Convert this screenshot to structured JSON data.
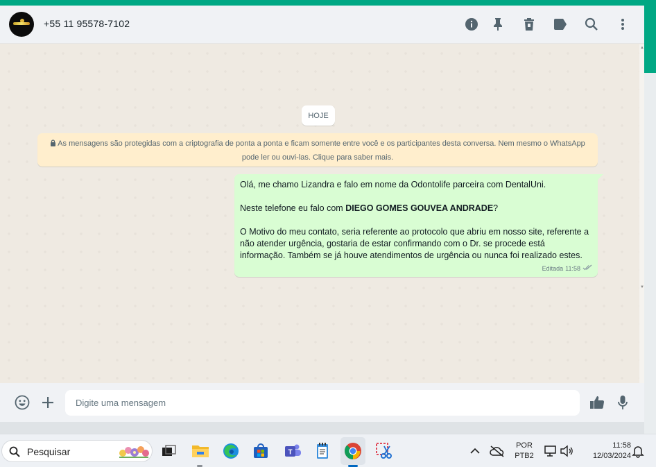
{
  "header": {
    "contact_name": "+55 11 95578-7102",
    "icons": [
      "info-icon",
      "pin-icon",
      "trash-icon",
      "label-icon",
      "search-icon",
      "menu-icon"
    ]
  },
  "chat": {
    "day_label": "HOJE",
    "encryption_notice": "As mensagens são protegidas com a criptografia de ponta a ponta e ficam somente entre você e os participantes desta conversa. Nem mesmo o WhatsApp pode ler ou ouvi-las. Clique para saber mais.",
    "message": {
      "line1": "Olá, me chamo Lizandra e falo em nome da Odontolife parceira com DentalUni.",
      "line2_prefix": "Neste telefone eu falo com ",
      "line2_bold": "DIEGO GOMES GOUVEA ANDRADE",
      "line2_suffix": "?",
      "line3": "O Motivo do meu contato, seria referente ao protocolo que abriu em nosso site, referente a não atender urgência, gostaria de estar confirmando com o Dr. se procede está informação. Também se já houve atendimentos de urgência ou nunca foi realizado estes.",
      "status": "Editada",
      "time": "11:58"
    }
  },
  "composer": {
    "placeholder": "Digite uma mensagem"
  },
  "taskbar": {
    "search_placeholder": "Pesquisar",
    "language": "POR",
    "layout": "PTB2",
    "time": "11:58",
    "date": "12/03/2024"
  },
  "colors": {
    "accent": "#00a884",
    "bubble_out": "#d9fdd3",
    "notice_bg": "#ffeecd",
    "chat_bg": "#efeae2"
  }
}
